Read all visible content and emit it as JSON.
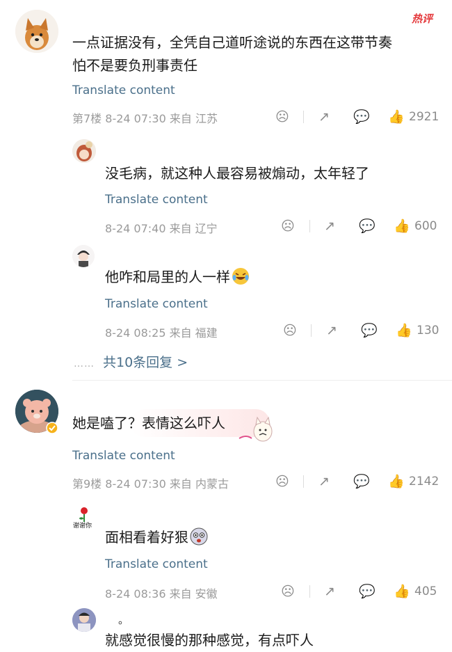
{
  "hot_badge": "热评",
  "translate_label": "Translate content",
  "colors": {
    "link": "#4a6f8a",
    "meta": "#9a9a9a",
    "hot": "#e4393c"
  },
  "icons": [
    "dislike-icon",
    "share-icon",
    "comment-icon",
    "like-icon"
  ],
  "comments": [
    {
      "text": "一点证据没有，全凭自己道听途说的东西在这带节奏怕不是要负刑事责任",
      "text_line1": "一点证据没有，全凭自己道听途说的东西在这带节奏",
      "text_line2": "怕不是要负刑事责任",
      "meta": "第7楼 8-24 07:30 来自 江苏",
      "likes": "2921",
      "replies": [
        {
          "text": "没毛病，就这种人最容易被煽动，太年轻了",
          "meta": "8-24 07:40 来自 辽宁",
          "likes": "600"
        },
        {
          "text": "他咋和局里的人一样",
          "meta": "8-24 08:25 来自 福建",
          "likes": "130"
        }
      ],
      "more_replies": "共10条回复 >",
      "more_dots": "……"
    },
    {
      "text": "她是嗑了？表情这么吓人",
      "meta": "第9楼 8-24 07:30 来自 内蒙古",
      "likes": "2142",
      "replies": [
        {
          "text": "面相看着好狠",
          "meta": "8-24 08:36 来自 安徽",
          "likes": "405",
          "avatar_caption": "谢谢你"
        },
        {
          "text": "就感觉很慢的那种感觉，有点吓人",
          "text_top": "。"
        }
      ]
    }
  ]
}
